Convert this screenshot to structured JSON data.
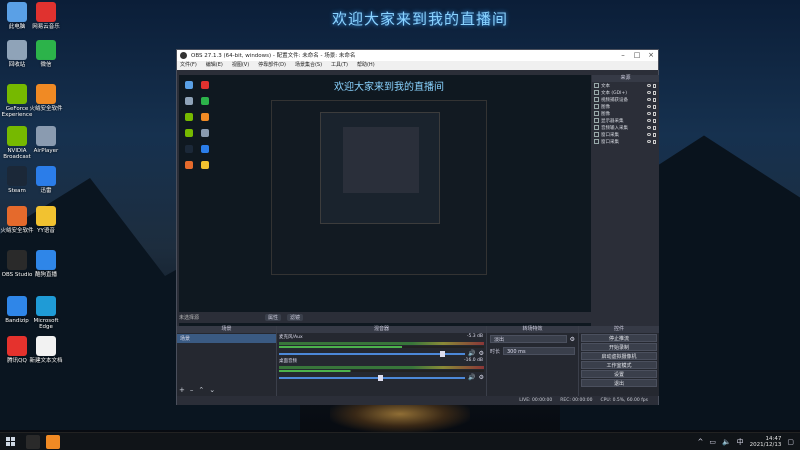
{
  "wallpaper": {
    "title": "欢迎大家来到我的直播间"
  },
  "desktop_icons": [
    {
      "label": "此电脑",
      "color": "#5aa0e6"
    },
    {
      "label": "网易云音乐",
      "color": "#e0322f"
    },
    {
      "label": "回收站",
      "color": "#8fa3b8"
    },
    {
      "label": "微信",
      "color": "#2cb34a"
    },
    {
      "label": "GeForce Experience",
      "color": "#76b900"
    },
    {
      "label": "火绒安全软件",
      "color": "#f08a24"
    },
    {
      "label": "NVIDIA Broadcast",
      "color": "#76b900"
    },
    {
      "label": "AirPlayer",
      "color": "#8a9bb0"
    },
    {
      "label": "Steam",
      "color": "#1b2838"
    },
    {
      "label": "迅雷",
      "color": "#2b7de9"
    },
    {
      "label": "火绒安全软件",
      "color": "#e56a2c"
    },
    {
      "label": "YY语音",
      "color": "#f2c230"
    },
    {
      "label": "OBS Studio",
      "color": "#2a2a2a"
    },
    {
      "label": "酷狗直播",
      "color": "#2f86e8"
    },
    {
      "label": "Bandizip",
      "color": "#2f86e8"
    },
    {
      "label": "Microsoft Edge",
      "color": "#1f9bd6"
    },
    {
      "label": "腾讯QQ",
      "color": "#e5322d"
    },
    {
      "label": "新建文本文档",
      "color": "#f2f2f2"
    }
  ],
  "obs": {
    "window_title": "OBS 27.1.3 (64-bit, windows) - 配置文件: 未命名 - 场景: 未命名",
    "menu": [
      "文件(F)",
      "编辑(E)",
      "视图(V)",
      "停靠部件(D)",
      "场景集合(S)",
      "工具(T)",
      "帮助(H)"
    ],
    "preview_title": "欢迎大家来到我的直播间",
    "sources_header": "来源",
    "sources": [
      "文本",
      "文本 (GDI+)",
      "视频捕获设备",
      "图像",
      "图像",
      "显示器采集",
      "音频输入采集",
      "窗口采集",
      "窗口采集"
    ],
    "docks_label": "未选择源",
    "dock_tabs": [
      "属性",
      "滤镜"
    ],
    "scenes_header": "场景",
    "scenes": [
      "场景"
    ],
    "mixer_header": "混音器",
    "mixer": [
      {
        "name": "麦克风/Aux",
        "db": "-5.3 dB",
        "level": 0.6,
        "volume": 0.88
      },
      {
        "name": "桌面音频",
        "db": "-16.0 dB",
        "level": 0.35,
        "volume": 0.55
      }
    ],
    "transitions_header": "转场特效",
    "transition": {
      "label": "",
      "value": "淡出",
      "duration_label": "时长",
      "duration": "300 ms"
    },
    "controls_header": "控件",
    "controls": [
      "停止推流",
      "开始录制",
      "启动虚拟摄像机",
      "工作室模式",
      "设置",
      "退出"
    ],
    "status": {
      "live": "LIVE: 00:00:00",
      "rec": "REC: 00:00:00",
      "cpu": "CPU: 0.5%, 60.00 fps"
    }
  },
  "taskbar": {
    "time": "14:47",
    "date": "2021/12/13",
    "lang": "中",
    "colors": {
      "obs": "#2a2a2a",
      "app2": "#f08a24"
    }
  }
}
